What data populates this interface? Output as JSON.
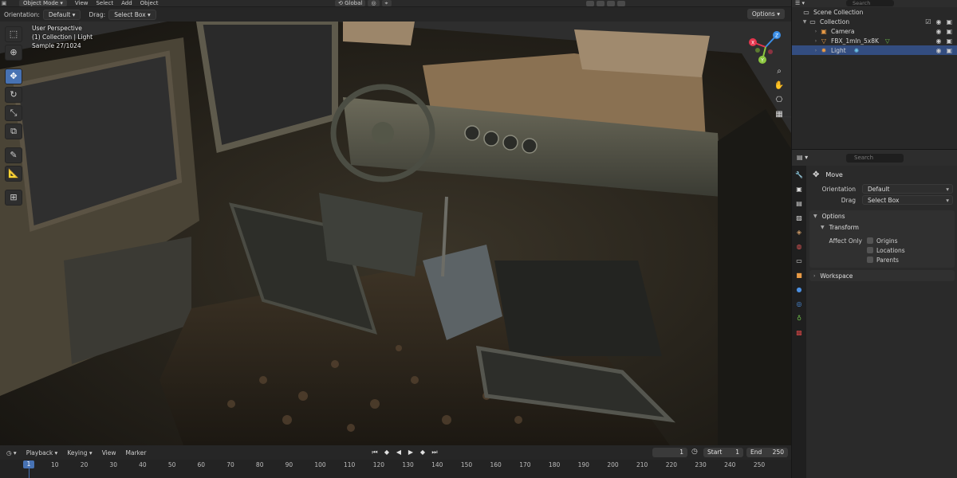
{
  "header": {
    "mode": "Object Mode",
    "menus": [
      "View",
      "Select",
      "Add",
      "Object"
    ],
    "transform_orientation": "Global",
    "search_placeholder": "Search"
  },
  "tool_header": {
    "orientation_label": "Orientation:",
    "orientation_value": "Default",
    "drag_label": "Drag:",
    "drag_value": "Select Box",
    "options_label": "Options"
  },
  "viewport": {
    "perspective": "User Perspective",
    "collection_info": "(1) Collection | Light",
    "sample": "Sample 27/1024",
    "gizmo_axes": [
      "X",
      "Y",
      "Z"
    ]
  },
  "toolbar": {
    "tools": [
      "select-box",
      "cursor",
      "move",
      "rotate",
      "scale",
      "transform",
      "annotate",
      "measure",
      "add-cube"
    ],
    "active_tool": "move"
  },
  "outliner": {
    "search_placeholder": "Search",
    "root": "Scene Collection",
    "collection": "Collection",
    "items": [
      {
        "name": "Camera",
        "icon": "camera-icon",
        "selected": false
      },
      {
        "name": "FBX_1mln_5x8K",
        "icon": "mesh-icon",
        "selected": false
      },
      {
        "name": "Light",
        "icon": "light-icon",
        "selected": true
      }
    ]
  },
  "properties": {
    "search_placeholder": "Search",
    "tool_title": "Move",
    "orientation_label": "Orientation",
    "orientation_value": "Default",
    "drag_label": "Drag",
    "drag_value": "Select Box",
    "options_panel": "Options",
    "transform_panel": "Transform",
    "affect_only_label": "Affect Only",
    "affect_only": [
      "Origins",
      "Locations",
      "Parents"
    ],
    "workspace_panel": "Workspace"
  },
  "timeline": {
    "menus": [
      "Playback",
      "Keying",
      "View",
      "Marker"
    ],
    "current_frame": "1",
    "start_label": "Start",
    "start": "1",
    "end_label": "End",
    "end": "250",
    "ticks": [
      "1",
      "10",
      "20",
      "30",
      "40",
      "50",
      "60",
      "70",
      "80",
      "90",
      "100",
      "110",
      "120",
      "130",
      "140",
      "150",
      "160",
      "170",
      "180",
      "190",
      "200",
      "210",
      "220",
      "230",
      "240",
      "250"
    ]
  },
  "colors": {
    "accent": "#4772b3",
    "selection": "#334d80",
    "axis_x": "#e5364e",
    "axis_y": "#8bc63f",
    "axis_z": "#3b8ee6"
  }
}
